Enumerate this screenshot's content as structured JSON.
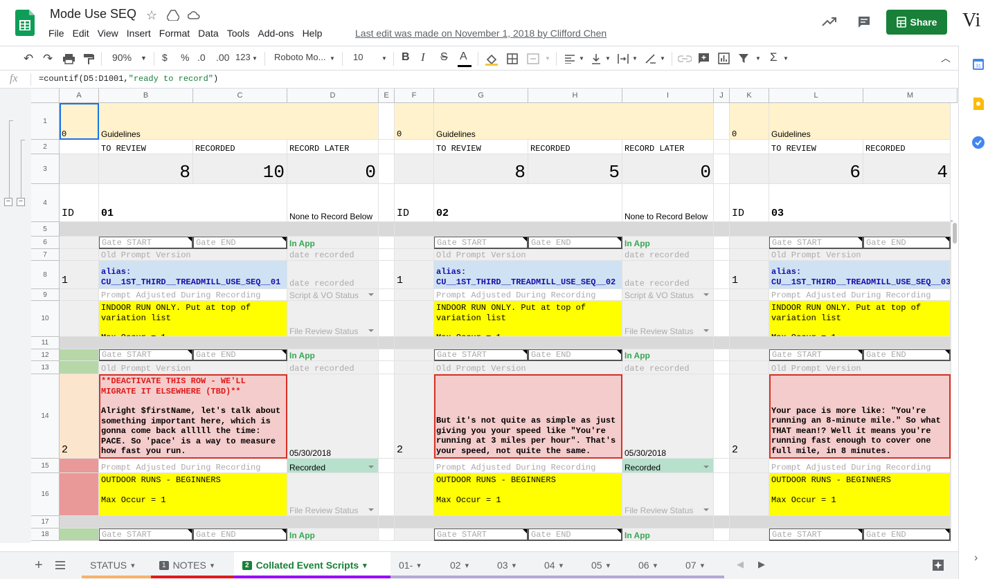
{
  "title": "Mode Use SEQ",
  "menu": [
    "File",
    "Edit",
    "View",
    "Insert",
    "Format",
    "Data",
    "Tools",
    "Add-ons",
    "Help"
  ],
  "last_edit": "Last edit was made on November 1, 2018 by Clifford Chen",
  "share_label": "Share",
  "account_initial": "Vi",
  "toolbar": {
    "zoom": "90%",
    "currency": "$",
    "percent": "%",
    "dec_less": ".0",
    "dec_more": ".00",
    "format_more": "123",
    "font": "Roboto Mo...",
    "font_size": "10",
    "bold": "B",
    "italic": "I",
    "strike": "S",
    "text_color": "A"
  },
  "formula_bar": {
    "fx": "fx",
    "formula_prefix": "=countif(D5:D1001,",
    "formula_string": "\"ready to record\"",
    "formula_suffix": ")"
  },
  "columns": [
    "A",
    "B",
    "C",
    "D",
    "E",
    "F",
    "G",
    "H",
    "I",
    "J",
    "K",
    "L",
    "M"
  ],
  "rows": [
    "1",
    "2",
    "3",
    "4",
    "5",
    "6",
    "7",
    "8",
    "9",
    "10",
    "11",
    "12",
    "13",
    "14",
    "15",
    "16",
    "17",
    "18"
  ],
  "blocks": [
    {
      "a1": "0",
      "guidelines": "Guidelines",
      "to_review": "TO REVIEW",
      "recorded": "RECORDED",
      "record_later": "RECORD LATER",
      "n_review": "8",
      "n_recorded": "10",
      "n_later": "0",
      "id_label": "ID",
      "block_id": "01",
      "none_record": "None to Record Below",
      "gate_start": "Gate START",
      "gate_end": "Gate END",
      "in_app": "In App",
      "old_prompt": "Old Prompt Version",
      "date_recorded": "date recorded",
      "r8_id": "1",
      "alias": "alias: CU__1ST_THIRD__TREADMILL_USE_SEQ__01",
      "prompt_adjusted": "Prompt Adjusted During Recording",
      "script_status": "Script & VO Status",
      "r10_text": "INDOOR RUN ONLY. Put at top of variation list",
      "max_occur": "Max Occur = 1",
      "file_review": "File Review Status",
      "r14_id": "2",
      "r14_warning": "**DEACTIVATE THIS ROW - WE'LL MIGRATE IT ELSEWHERE (TBD)**",
      "r14_text": "Alright $firstName, let's talk about something important here, which is gonna come back alllll the time: PACE. So 'pace' is a way to measure how fast you run.",
      "r14_date": "05/30/2018",
      "r15_status": "Recorded",
      "r16_text": "OUTDOOR RUNS - BEGINNERS"
    },
    {
      "a1": "0",
      "guidelines": "Guidelines",
      "to_review": "TO REVIEW",
      "recorded": "RECORDED",
      "record_later": "RECORD LATER",
      "n_review": "8",
      "n_recorded": "5",
      "n_later": "0",
      "id_label": "ID",
      "block_id": "02",
      "none_record": "None to Record Below",
      "gate_start": "Gate START",
      "gate_end": "Gate END",
      "in_app": "In App",
      "old_prompt": "Old Prompt Version",
      "date_recorded": "date recorded",
      "r8_id": "1",
      "alias": "alias: CU__1ST_THIRD__TREADMILL_USE_SEQ__02",
      "prompt_adjusted": "Prompt Adjusted During Recording",
      "script_status": "Script & VO Status",
      "r10_text": "INDOOR RUN ONLY. Put at top of variation list",
      "max_occur": "Max Occur = 1",
      "file_review": "File Review Status",
      "r14_id": "2",
      "r14_warning": "",
      "r14_text": "But it's not quite as simple as just giving you your speed like \"You're running at 3 miles per hour\". That's your speed, not quite the same.",
      "r14_date": "05/30/2018",
      "r15_status": "Recorded",
      "r16_text": "OUTDOOR RUNS - BEGINNERS"
    },
    {
      "a1": "0",
      "guidelines": "Guidelines",
      "to_review": "TO REVIEW",
      "recorded": "RECORDED",
      "record_later": "",
      "n_review": "6",
      "n_recorded": "4",
      "n_later": "",
      "id_label": "ID",
      "block_id": "03",
      "none_record": "",
      "gate_start": "Gate START",
      "gate_end": "Gate END",
      "in_app": "",
      "old_prompt": "Old Prompt Version",
      "date_recorded": "",
      "r8_id": "1",
      "alias": "alias: CU__1ST_THIRD__TREADMILL_USE_SEQ__03",
      "prompt_adjusted": "Prompt Adjusted During Recording",
      "script_status": "",
      "r10_text": "INDOOR RUN ONLY. Put at top of variation list",
      "max_occur": "Max Occur = 1",
      "file_review": "",
      "r14_id": "2",
      "r14_warning": "",
      "r14_text": "Your pace is more like: \"You're running an 8-minute mile.\" So what THAT mean!? Well it means you're running fast enough to cover one full mile, in 8 minutes.",
      "r14_date": "",
      "r15_status": "",
      "r16_text": "OUTDOOR RUNS - BEGINNERS"
    }
  ],
  "sheets": [
    {
      "label": "STATUS",
      "badge": "",
      "color": "#f6b26b"
    },
    {
      "label": "NOTES",
      "badge": "1",
      "color": "#e01b1b"
    },
    {
      "label": "Collated Event Scripts",
      "badge": "2",
      "color": "#9900ff"
    },
    {
      "label": "01-",
      "badge": "",
      "color": "#b4a7d6"
    },
    {
      "label": "02",
      "badge": "",
      "color": "#b4a7d6"
    },
    {
      "label": "03",
      "badge": "",
      "color": "#b4a7d6"
    },
    {
      "label": "04",
      "badge": "",
      "color": "#b4a7d6"
    },
    {
      "label": "05",
      "badge": "",
      "color": "#b4a7d6"
    },
    {
      "label": "06",
      "badge": "",
      "color": "#b4a7d6"
    },
    {
      "label": "07",
      "badge": "",
      "color": "#b4a7d6"
    }
  ]
}
